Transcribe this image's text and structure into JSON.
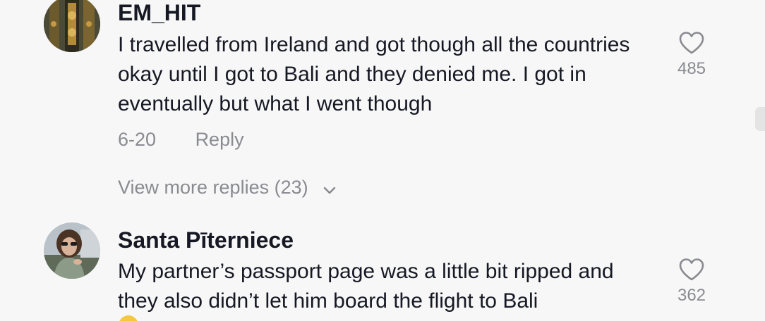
{
  "comments": [
    {
      "username": "EM_HIT",
      "text": "I travelled from Ireland and got though all the countries okay until I got to Bali and they denied me. I got in eventually but what I went though",
      "date": "6-20",
      "reply_label": "Reply",
      "likes": "485",
      "avatar_icon": "avatar-photo-dark-gold",
      "view_more": "View more replies (23)"
    },
    {
      "username": "Santa Pīterniece",
      "text": "My partner’s passport page was a little bit ripped and they also didn’t let him board the flight to Bali",
      "likes": "362",
      "avatar_icon": "avatar-photo-woman-sunglasses"
    }
  ],
  "colors": {
    "background": "#f7f7f7",
    "primary_text": "#161823",
    "secondary_text": "#8a8b91"
  }
}
